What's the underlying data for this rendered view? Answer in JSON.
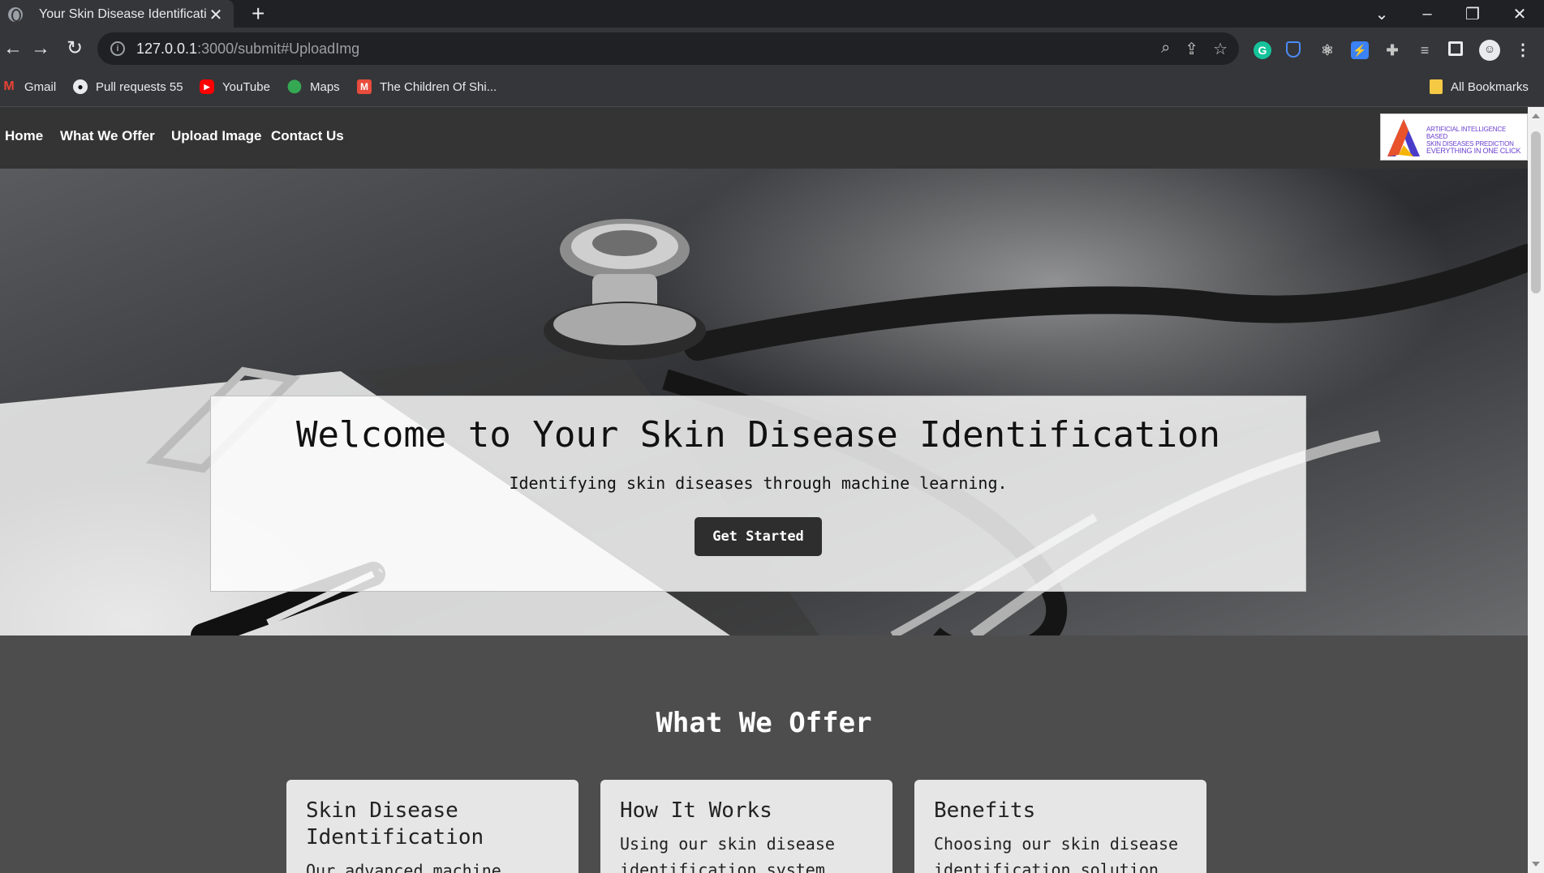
{
  "browser": {
    "tab_title": "Your Skin Disease Identification",
    "url_host": "127.0.0.1",
    "url_path": ":3000/submit#UploadImg",
    "bookmarks": [
      {
        "label": "Gmail",
        "icon": "gmail-icon"
      },
      {
        "label": "Pull requests 55",
        "icon": "github-icon"
      },
      {
        "label": "YouTube",
        "icon": "youtube-icon"
      },
      {
        "label": "Maps",
        "icon": "maps-icon"
      },
      {
        "label": "The Children Of Shi...",
        "icon": "bookmark-m-icon"
      }
    ],
    "all_bookmarks": "All Bookmarks"
  },
  "nav": {
    "home": "Home",
    "offer": "What We Offer",
    "upload": "Upload Image",
    "contact": "Contact Us"
  },
  "logo": {
    "line1": "ARTIFICIAL INTELLIGENCE BASED",
    "line2": "SKIN DISEASES PREDICTION",
    "line3": "EVERYTHING IN ONE CLICK"
  },
  "hero": {
    "title": "Welcome to Your Skin Disease Identification",
    "subtitle": "Identifying skin diseases through machine learning.",
    "cta": "Get Started"
  },
  "offer": {
    "title": "What We Offer",
    "cards": [
      {
        "title": "Skin Disease Identification",
        "text": "Our advanced machine"
      },
      {
        "title": "How It Works",
        "text": "Using our skin disease identification system"
      },
      {
        "title": "Benefits",
        "text": "Choosing our skin disease identification solution"
      }
    ]
  },
  "colors": {
    "nav_bg": "#343434",
    "section_bg": "#4d4d4d",
    "cta_bg": "#2e2e2e"
  }
}
